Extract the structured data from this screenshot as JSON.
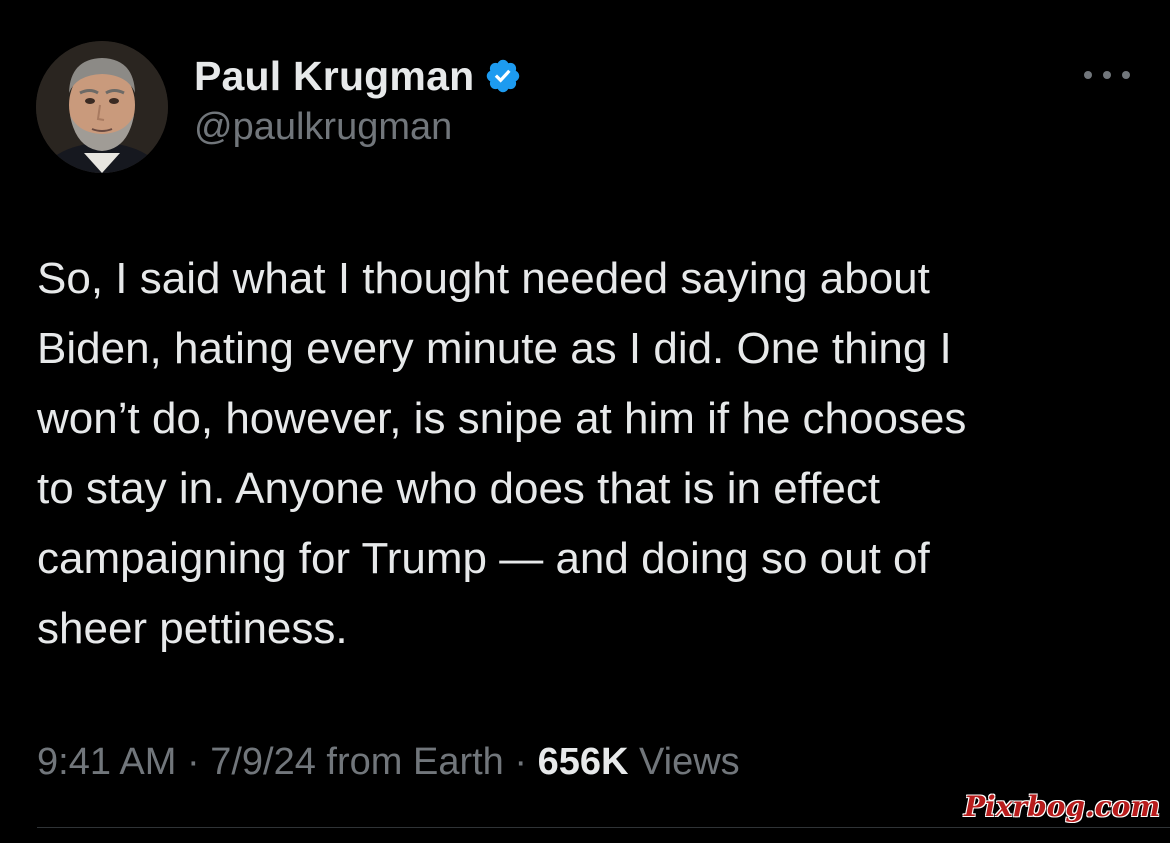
{
  "author": {
    "display_name": "Paul Krugman",
    "handle": "@paulkrugman",
    "verified": true,
    "verified_color": "#1d9bf0"
  },
  "tweet": {
    "text_lines": [
      "So, I said what I thought needed saying about",
      "Biden, hating every minute as I did. One thing I",
      "won’t do, however, is snipe at him if he chooses",
      "to stay in. Anyone who does that is in effect",
      "campaigning for Trump — and doing so out of",
      "sheer pettiness."
    ]
  },
  "meta": {
    "time": "9:41 AM",
    "separator": "·",
    "date": "7/9/24",
    "source": "from Earth",
    "views_count": "656K",
    "views_label": "Views"
  },
  "watermark": "Pixrbog.com",
  "icons": {
    "more": "more-horizontal-icon",
    "verified": "verified-badge-icon"
  },
  "colors": {
    "background": "#000000",
    "primary_text": "#e7e9ea",
    "secondary_text": "#71767b",
    "watermark": "#b81c1c"
  }
}
